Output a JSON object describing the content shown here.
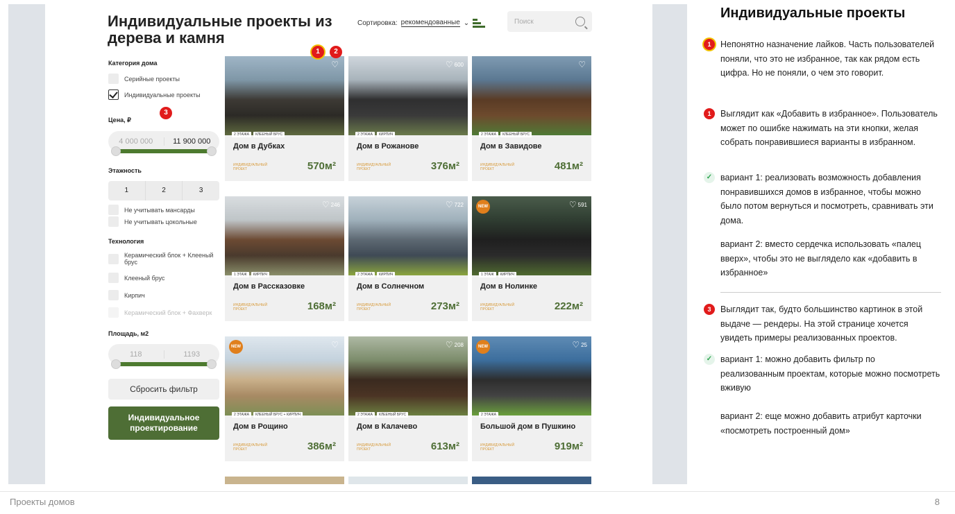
{
  "site": {
    "title": "Индивидуальные проекты из дерева и камня",
    "sort_label": "Сортировка:",
    "sort_value": "рекомендованные",
    "search_placeholder": "Поиск"
  },
  "filters": {
    "category_heading": "Категория дома",
    "category_options": [
      {
        "label": "Серийные проекты",
        "checked": false
      },
      {
        "label": "Индивидуальные проекты",
        "checked": true
      }
    ],
    "price_heading": "Цена, ₽",
    "price_min": "4 000 000",
    "price_max": "11 900 000",
    "floors_heading": "Этажность",
    "floors_options": [
      "1",
      "2",
      "3"
    ],
    "floor_checks": [
      "Не учитывать мансарды",
      "Не учитывать цокольные"
    ],
    "tech_heading": "Технология",
    "tech_options": [
      "Керамический блок + Клееный брус",
      "Клееный брус",
      "Кирпич",
      "Керамический блок + Фахверк"
    ],
    "area_heading": "Площадь, м2",
    "area_min": "118",
    "area_max": "1193",
    "reset_label": "Сбросить фильтр",
    "cta_label": "Индивидуальное проектирование"
  },
  "cards": [
    {
      "name": "Дом в Дубках",
      "tags": [
        "2 ЭТАЖА",
        "КЛЕЕНЫЙ БРУС"
      ],
      "area": "570м²",
      "type": "ИНДИВИДУАЛЬНЫЙ ПРОЕКТ",
      "likes": "",
      "new": ""
    },
    {
      "name": "Дом в Рожанове",
      "tags": [
        "2 ЭТАЖА",
        "КИРПИЧ"
      ],
      "area": "376м²",
      "type": "ИНДИВИДУАЛЬНЫЙ ПРОЕКТ",
      "likes": "600",
      "new": ""
    },
    {
      "name": "Дом в Завидове",
      "tags": [
        "2 ЭТАЖА",
        "КЛЕЕНЫЙ БРУС"
      ],
      "area": "481м²",
      "type": "ИНДИВИДУАЛЬНЫЙ ПРОЕКТ",
      "likes": "",
      "new": ""
    },
    {
      "name": "Дом в Рассказовке",
      "tags": [
        "1 ЭТАЖ",
        "КИРПИЧ"
      ],
      "area": "168м²",
      "type": "ИНДИВИДУАЛЬНЫЙ ПРОЕКТ",
      "likes": "246",
      "new": ""
    },
    {
      "name": "Дом в Солнечном",
      "tags": [
        "2 ЭТАЖА",
        "КИРПИЧ"
      ],
      "area": "273м²",
      "type": "ИНДИВИДУАЛЬНЫЙ ПРОЕКТ",
      "likes": "722",
      "new": ""
    },
    {
      "name": "Дом в Нолинке",
      "tags": [
        "1 ЭТАЖ",
        "КИРПИЧ"
      ],
      "area": "222м²",
      "type": "ИНДИВИДУАЛЬНЫЙ ПРОЕКТ",
      "likes": "591",
      "new": "NEW"
    },
    {
      "name": "Дом в Рощино",
      "tags": [
        "2 ЭТАЖА",
        "КЛЕЕНЫЙ БРУС + КИРПИЧ"
      ],
      "area": "386м²",
      "type": "ИНДИВИДУАЛЬНЫЙ ПРОЕКТ",
      "likes": "",
      "new": "NEW"
    },
    {
      "name": "Дом в Калачево",
      "tags": [
        "2 ЭТАЖА",
        "КЛЕЕНЫЙ БРУС"
      ],
      "area": "613м²",
      "type": "ИНДИВИДУАЛЬНЫЙ ПРОЕКТ",
      "likes": "208",
      "new": ""
    },
    {
      "name": "Большой дом в Пушкино",
      "tags": [
        "2 ЭТАЖА"
      ],
      "area": "919м²",
      "type": "ИНДИВИДУАЛЬНЫЙ ПРОЕКТ",
      "likes": "25",
      "new": "NEW"
    }
  ],
  "markers": [
    "1",
    "2",
    "3"
  ],
  "notes": {
    "title": "Индивидуальные проекты",
    "items": [
      {
        "icon": "1",
        "text": "Непонятно назначение лайков. Часть пользователей поняли, что это не избранное, так как рядом есть цифра. Но не поняли, о чем это говорит."
      },
      {
        "icon": "1",
        "text": "Выглядит как «Добавить в избранное». Пользователь может по ошибке нажимать на эти кнопки, желая собрать понравившиеся варианты в избранном."
      },
      {
        "icon": "✓",
        "text": "вариант 1: реализовать возможность добавления понравившихся домов в избранное, чтобы можно было потом вернуться и посмотреть, сравнивать эти дома."
      },
      {
        "icon": "",
        "text": "вариант 2: вместо сердечка использовать «палец вверх», чтобы это не выглядело как «добавить в избранное»"
      },
      {
        "icon": "3",
        "text": "Выглядит так, будто большинство картинок в этой выдаче — рендеры. На этой странице хочется увидеть примеры реализованных проектов."
      },
      {
        "icon": "✓",
        "text": "вариант 1: можно добавить фильтр по реализованным проектам, которые можно посмотреть вживую"
      },
      {
        "icon": "",
        "text": "вариант 2: еще можно добавить атрибут карточки «посмотреть построенный дом»"
      }
    ]
  },
  "footer": {
    "left": "Проекты домов",
    "page": "8"
  },
  "colors": {
    "brand_green": "#4e6e35",
    "marker_red": "#e11b1b",
    "marker_ring": "#f2c200",
    "new_badge": "#e07f1c"
  }
}
